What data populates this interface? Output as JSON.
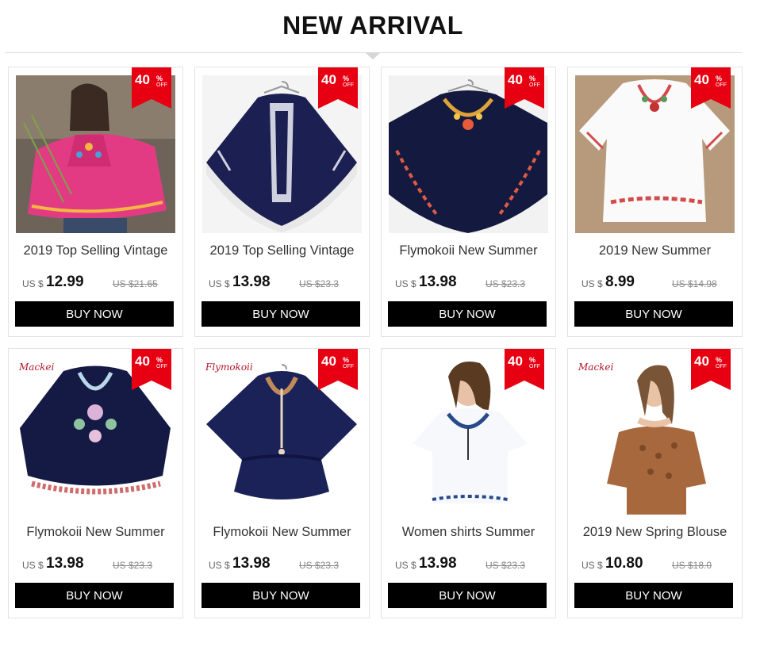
{
  "header": {
    "title": "NEW ARRIVAL"
  },
  "badge": {
    "number": "40",
    "percent": "%",
    "off": "OFF",
    "color": "#e60012"
  },
  "products": [
    {
      "title": "2019 Top Selling Vintage",
      "currency": "US $",
      "price": "12.99",
      "old_price": "US $21.65",
      "button": "BUY NOW",
      "image": "pink-embroidered-batwing-blouse"
    },
    {
      "title": "2019 Top Selling Vintage",
      "currency": "US $",
      "price": "13.98",
      "old_price": "US $23.3",
      "button": "BUY NOW",
      "image": "navy-tribal-poncho-top"
    },
    {
      "title": "Flymokoii New Summer",
      "currency": "US $",
      "price": "13.98",
      "old_price": "US $23.3",
      "button": "BUY NOW",
      "image": "navy-floral-batwing-top"
    },
    {
      "title": "2019 New Summer",
      "currency": "US $",
      "price": "8.99",
      "old_price": "US $14.98",
      "button": "BUY NOW",
      "image": "white-floral-peasant-blouse"
    },
    {
      "title": "Flymokoii New Summer",
      "currency": "US $",
      "price": "13.98",
      "old_price": "US $23.3",
      "button": "BUY NOW",
      "image": "navy-embroidered-tunic",
      "logo": "Mackei"
    },
    {
      "title": "Flymokoii New Summer",
      "currency": "US $",
      "price": "13.98",
      "old_price": "US $23.3",
      "button": "BUY NOW",
      "image": "navy-peplum-batwing-top",
      "logo": "Flymokoii"
    },
    {
      "title": "Women shirts Summer",
      "currency": "US $",
      "price": "13.98",
      "old_price": "US $23.3",
      "button": "BUY NOW",
      "image": "white-blouse-on-model"
    },
    {
      "title": "2019 New Spring Blouse",
      "currency": "US $",
      "price": "10.80",
      "old_price": "US $18.0",
      "button": "BUY NOW",
      "image": "brown-lace-off-shoulder-blouse",
      "logo": "Mackei"
    }
  ]
}
